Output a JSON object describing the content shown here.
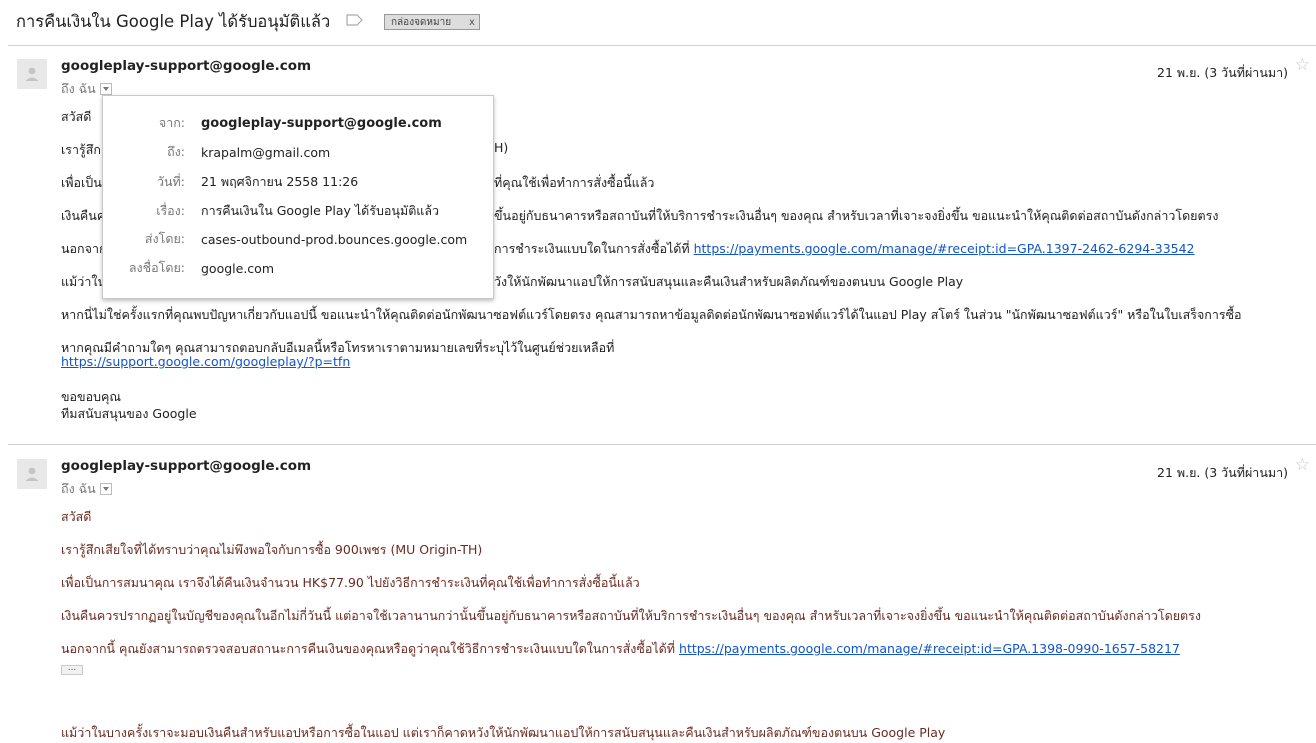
{
  "thread": {
    "subject": "การคืนเงินใน Google Play ได้รับอนุมัติแล้ว",
    "label": "กล่องจดหมาย",
    "label_remove": "x"
  },
  "messages": [
    {
      "sender": "googleplay-support@google.com",
      "to": "ถึง ฉัน",
      "date": "21 พ.ย. (3 วันที่ผ่านมา)",
      "lines": [
        "สวัสดี",
        "เรารู้สึก",
        "เพื่อเป็น",
        "เงินคืนค",
        "นอกจาก",
        "แม้ว่าใน",
        "หากนี่ไม่ใช่ครั้งแรกที่คุณพบปัญหาเกี่ยวกับแอปนี้ ขอแนะนำให้คุณติดต่อนักพัฒนาซอฟต์แวร์โดยตรง คุณสามารถหาข้อมูลติดต่อนักพัฒนาซอฟต์แวร์ได้ในแอป Play สโตร์ ในส่วน \"นักพัฒนาซอฟต์แวร์\" หรือในใบเสร็จการซื้อ",
        "หากคุณมีคำถามใดๆ คุณสามารถตอบกลับอีเมลนี้หรือโทรหาเราตามหมายเลขที่ระบุไว้ในศูนย์ช่วยเหลือที่",
        "https://support.google.com/googleplay/?p=tfn",
        "ขอขอบคุณ",
        "ทีมสนับสนุนของ Google"
      ],
      "partial_right": [
        "H)",
        "ที่คุณใช้เพื่อทำการสั่งซื้อนี้แล้ว",
        "ขึ้นอยู่กับธนาคารหรือสถาบันที่ให้บริการชำระเงินอื่นๆ ของคุณ สำหรับเวลาที่เจาะจงยิ่งขึ้น ขอแนะนำให้คุณติดต่อสถาบันดังกล่าวโดยตรง",
        "การชำระเงินแบบใดในการสั่งซื้อได้ที่",
        "https://payments.google.com/manage/#receipt:id=GPA.1397-2462-6294-33542",
        "วังให้นักพัฒนาแอปให้การสนับสนุนและคืนเงินสำหรับผลิตภัณฑ์ของตนบน Google Play"
      ]
    },
    {
      "sender": "googleplay-support@google.com",
      "to": "ถึง ฉัน",
      "date": "21 พ.ย. (3 วันที่ผ่านมา)",
      "lines": [
        "สวัสดี",
        "เรารู้สึกเสียใจที่ได้ทราบว่าคุณไม่พึงพอใจกับการซื้อ 900เพชร (MU Origin-TH)",
        "เพื่อเป็นการสมนาคุณ เราจึงได้คืนเงินจำนวน HK$77.90 ไปยังวิธีการชำระเงินที่คุณใช้เพื่อทำการสั่งซื้อนี้แล้ว",
        "เงินคืนควรปรากฏอยู่ในบัญชีของคุณในอีกไม่กี่วันนี้ แต่อาจใช้เวลานานกว่านั้นขึ้นอยู่กับธนาคารหรือสถาบันที่ให้บริการชำระเงินอื่นๆ ของคุณ สำหรับเวลาที่เจาะจงยิ่งขึ้น ขอแนะนำให้คุณติดต่อสถาบันดังกล่าวโดยตรง",
        "นอกจากนี้ คุณยังสามารถตรวจสอบสถานะการคืนเงินของคุณหรือดูว่าคุณใช้วิธีการชำระเงินแบบใดในการสั่งซื้อได้ที่",
        "https://payments.google.com/manage/#receipt:id=GPA.1398-0990-1657-58217",
        "แม้ว่าในบางครั้งเราจะมอบเงินคืนสำหรับแอปหรือการซื้อในแอป แต่เราก็คาดหวังให้นักพัฒนาแอปให้การสนับสนุนและคืนเงินสำหรับผลิตภัณฑ์ของตนบน Google Play"
      ],
      "ellipsis": "..."
    }
  ],
  "popup": {
    "from_key": "จาก:",
    "from_val": "googleplay-support@google.com",
    "to_key": "ถึง:",
    "to_val": "krapalm@gmail.com",
    "date_key": "วันที่:",
    "date_val": "21 พฤศจิกายน 2558 11:26",
    "subject_key": "เรื่อง:",
    "subject_val": "การคืนเงินใน Google Play ได้รับอนุมัติแล้ว",
    "mailedby_key": "ส่งโดย:",
    "mailedby_val": "cases-outbound-prod.bounces.google.com",
    "signedby_key": "ลงชื่อโดย:",
    "signedby_val": "google.com"
  },
  "icons": {
    "label": "label-tag-icon",
    "avatar": "person-icon",
    "star": "star-icon",
    "dropdown": "chevron-down-icon"
  }
}
